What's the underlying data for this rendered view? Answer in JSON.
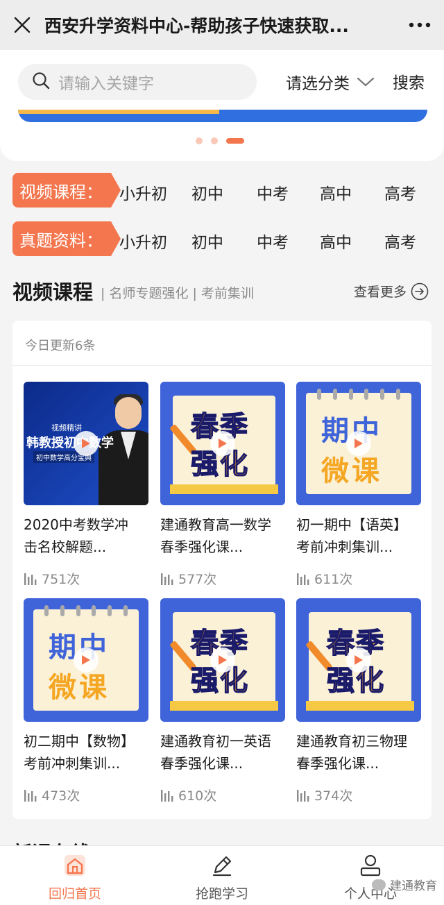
{
  "topbar": {
    "title": "西安升学资料中心-帮助孩子快速获取..."
  },
  "search": {
    "placeholder": "请输入关键字",
    "category_label": "请选分类",
    "search_button": "搜索"
  },
  "banner": {
    "slide_count": 3,
    "active_index": 2
  },
  "categories": [
    {
      "tag": "视频课程：",
      "items": [
        "小升初",
        "初中",
        "中考",
        "高中",
        "高考"
      ]
    },
    {
      "tag": "真题资料：",
      "items": [
        "小升初",
        "初中",
        "中考",
        "高中",
        "高考"
      ]
    }
  ],
  "section": {
    "title": "视频课程",
    "subtitle": "| 名师专题强化 | 考前集训",
    "more": "查看更多"
  },
  "card": {
    "updated": "今日更新6条",
    "courses": [
      {
        "line1": "2020中考数学冲",
        "line2": "击名校解题...",
        "views": "751次",
        "thumb": "professor"
      },
      {
        "line1": "建通教育高一数学",
        "line2": "春季强化课...",
        "views": "577次",
        "thumb": "spring"
      },
      {
        "line1": "初一期中【语英】",
        "line2": "考前冲刺集训...",
        "views": "611次",
        "thumb": "midterm"
      },
      {
        "line1": "初二期中【数物】",
        "line2": "考前冲刺集训...",
        "views": "473次",
        "thumb": "midterm"
      },
      {
        "line1": "建通教育初一英语",
        "line2": "春季强化课...",
        "views": "610次",
        "thumb": "spring"
      },
      {
        "line1": "建通教育初三物理",
        "line2": "春季强化课...",
        "views": "374次",
        "thumb": "spring"
      }
    ]
  },
  "thumb_text": {
    "professor_l1": "视频精讲",
    "professor_l2": "韩教授初中数学",
    "professor_l3": "初中数学高分宝典",
    "spring_1": "春季",
    "spring_2": "强化",
    "mid_1": "期中",
    "mid_2": "微课"
  },
  "next_section_peek": "新课在线",
  "bottomnav": {
    "items": [
      {
        "label": "回归首页",
        "icon": "home-icon",
        "active": true
      },
      {
        "label": "抢跑学习",
        "icon": "pencil-icon",
        "active": false
      },
      {
        "label": "个人中心",
        "icon": "user-icon",
        "active": false
      }
    ]
  },
  "watermark": "建通教育",
  "colors": {
    "accent": "#f3764e",
    "thumb_blue": "#3f63d9",
    "thumb_orange": "#f5a623"
  }
}
